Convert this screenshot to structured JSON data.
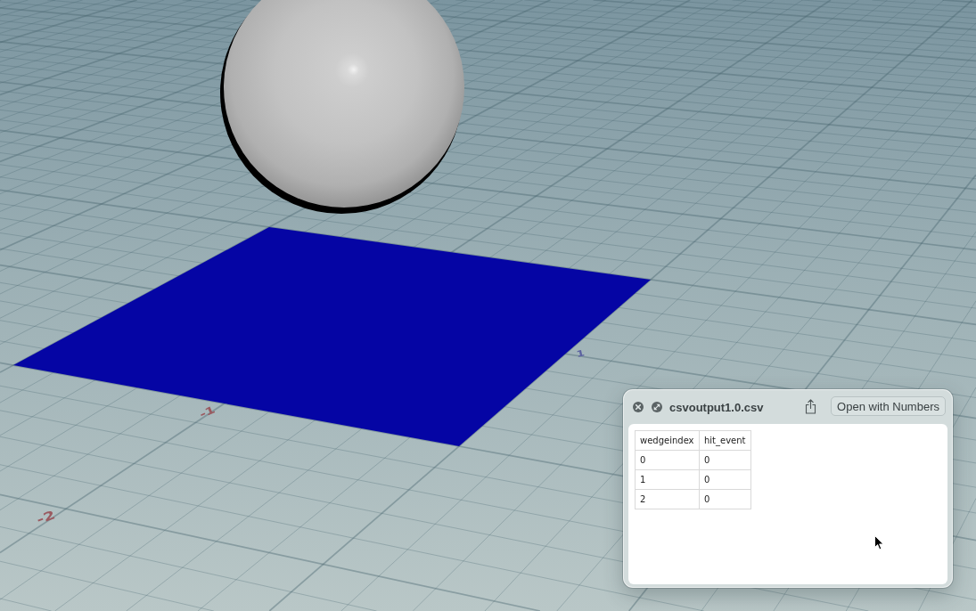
{
  "viewport": {
    "axis_labels": [
      {
        "text": "-1",
        "color": "#9a5a60"
      },
      {
        "text": "-2",
        "color": "#9a5a60"
      },
      {
        "text": "1",
        "color": "#5c62a0"
      }
    ]
  },
  "preview_window": {
    "title": "csvoutput1.0.csv",
    "open_button": "Open with Numbers",
    "table": {
      "columns": [
        "wedgeindex",
        "hit_event"
      ],
      "rows": [
        [
          "0",
          "0"
        ],
        [
          "1",
          "0"
        ],
        [
          "2",
          "0"
        ]
      ]
    }
  }
}
